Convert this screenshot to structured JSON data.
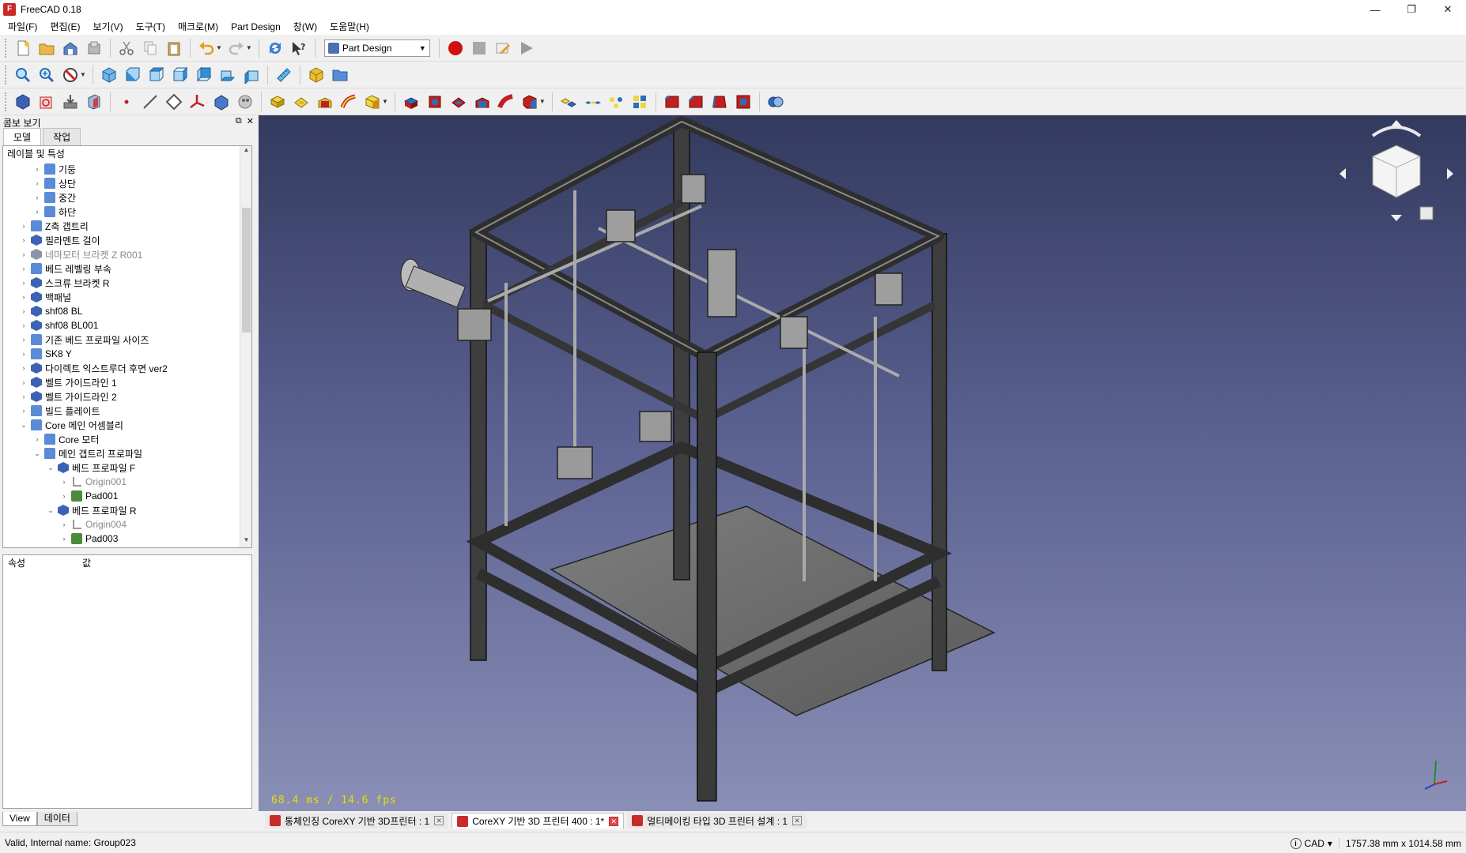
{
  "window": {
    "title": "FreeCAD 0.18",
    "minimize": "—",
    "restore": "❐",
    "close": "✕"
  },
  "menu": [
    "파일(F)",
    "편집(E)",
    "보기(V)",
    "도구(T)",
    "매크로(M)",
    "Part Design",
    "창(W)",
    "도움말(H)"
  ],
  "toolbar": {
    "workbench": "Part Design"
  },
  "combo": {
    "title": "콤보 보기",
    "tabs": [
      "모델",
      "작업"
    ],
    "tree_header": "레이블 및 특성",
    "tree": [
      {
        "label": "기둥",
        "icon": "folder"
      },
      {
        "label": "상단",
        "icon": "folder"
      },
      {
        "label": "중간",
        "icon": "folder"
      },
      {
        "label": "하단",
        "icon": "folder"
      },
      {
        "label": "Z축 갭트리",
        "icon": "folder"
      },
      {
        "label": "필라멘트 걸이",
        "icon": "body"
      },
      {
        "label": "네마모터 브라켓 Z R001",
        "icon": "body-grey"
      },
      {
        "label": "베드 레벨링 부속",
        "icon": "folder"
      },
      {
        "label": "스크류 브라켓 R",
        "icon": "body"
      },
      {
        "label": "백패널",
        "icon": "body"
      },
      {
        "label": "shf08 BL",
        "icon": "body"
      },
      {
        "label": "shf08 BL001",
        "icon": "body"
      },
      {
        "label": "기존 베드 프로파일 사이즈",
        "icon": "folder"
      },
      {
        "label": "SK8 Y",
        "icon": "folder"
      },
      {
        "label": "다이렉트 익스트루더 후면 ver2",
        "icon": "body"
      },
      {
        "label": "벨트 가이드라인 1",
        "icon": "body"
      },
      {
        "label": "벨트 가이드라인 2",
        "icon": "body"
      },
      {
        "label": "빌드 플레이트",
        "icon": "folder"
      },
      {
        "label": "Core 메인 어셈블리",
        "icon": "folder"
      },
      {
        "label": "Core 모터",
        "icon": "folder"
      },
      {
        "label": "메인 갭트리 프로파일",
        "icon": "folder"
      },
      {
        "label": "베드 프로파일 F",
        "icon": "body"
      },
      {
        "label": "Origin001",
        "icon": "origin"
      },
      {
        "label": "Pad001",
        "icon": "pad"
      },
      {
        "label": "베드 프로파일 R",
        "icon": "body"
      },
      {
        "label": "Origin004",
        "icon": "origin"
      },
      {
        "label": "Pad003",
        "icon": "pad"
      }
    ],
    "props_header": [
      "속성",
      "값"
    ],
    "bottom_tabs": [
      "View",
      "데이터"
    ]
  },
  "view": {
    "fps": "68.4 ms / 14.6 fps"
  },
  "doc_tabs": [
    {
      "label": "통체인징 CoreXY 기반 3D프린터 : 1"
    },
    {
      "label": "CoreXY 기반 3D 프린터 400 : 1*"
    },
    {
      "label": "멀티메이킹 타입 3D 프린터 설계 : 1"
    }
  ],
  "status": {
    "message": "Valid, Internal name: Group023",
    "nav_style": "CAD",
    "dimensions": "1757.38 mm x 1014.58 mm"
  },
  "colors": {
    "accent_red": "#c92a2a",
    "view_top": "#333a5e",
    "view_bottom": "#8a8fb6",
    "fps_text": "#e8e000"
  }
}
